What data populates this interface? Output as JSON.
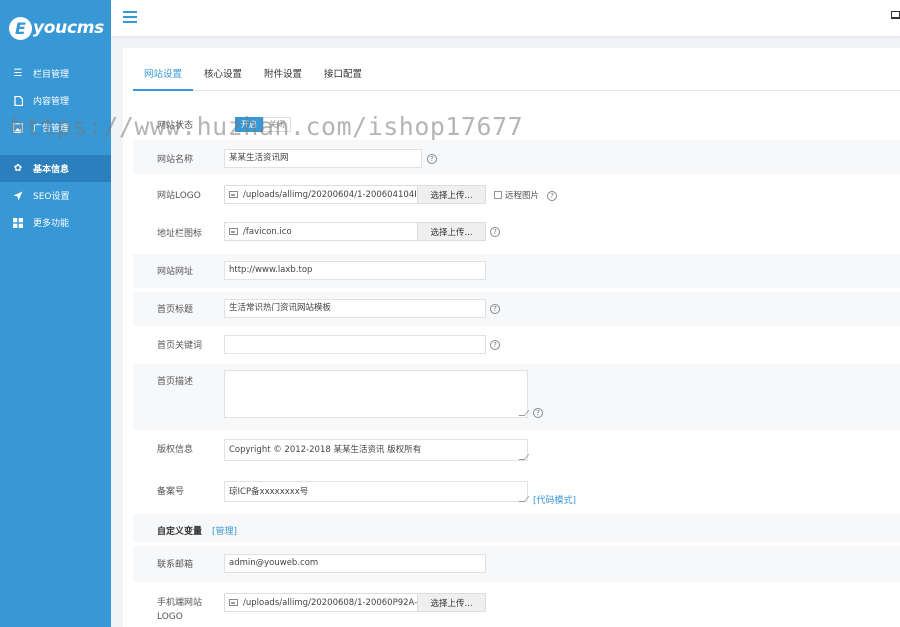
{
  "brand": {
    "badge": "E",
    "name": "youcms"
  },
  "sidebar": {
    "items": [
      {
        "label": "栏目管理",
        "icon": "list-icon"
      },
      {
        "label": "内容管理",
        "icon": "document-icon"
      },
      {
        "label": "广告管理",
        "icon": "image-icon"
      },
      {
        "label": "基本信息",
        "icon": "gear-icon",
        "active": true
      },
      {
        "label": "SEO设置",
        "icon": "send-icon"
      },
      {
        "label": "更多功能",
        "icon": "grid-icon"
      }
    ]
  },
  "tabs": [
    {
      "label": "网站设置",
      "active": true
    },
    {
      "label": "核心设置"
    },
    {
      "label": "附件设置"
    },
    {
      "label": "接口配置"
    }
  ],
  "form": {
    "status": {
      "label": "网站状态",
      "on": "开启",
      "off": "关闭"
    },
    "site_name": {
      "label": "网站名称",
      "value": "某某生活资讯网"
    },
    "site_logo": {
      "label": "网站LOGO",
      "value": "/uploads/allimg/20200604/1-200604104I",
      "button": "选择上传...",
      "remote": "远程图片"
    },
    "favicon": {
      "label": "地址栏图标",
      "value": "/favicon.ico",
      "button": "选择上传..."
    },
    "site_url": {
      "label": "网站网址",
      "value": "http://www.laxb.top"
    },
    "home_title": {
      "label": "首页标题",
      "value": "生活常识热门资讯网站模板"
    },
    "home_keywords": {
      "label": "首页关键词",
      "value": ""
    },
    "home_desc": {
      "label": "首页描述",
      "value": ""
    },
    "copyright": {
      "label": "版权信息",
      "value": "Copyright © 2012-2018 某某生活资讯 版权所有"
    },
    "icp": {
      "label": "备案号",
      "value": "琼ICP备xxxxxxxx号",
      "link": "[代码模式]"
    },
    "custom_vars": {
      "label": "自定义变量",
      "link": "[管理]"
    },
    "email": {
      "label": "联系邮箱",
      "value": "admin@youweb.com"
    },
    "mobile_logo": {
      "label_line1": "手机端网站",
      "label_line2": "LOGO",
      "value": "/uploads/allimg/20200608/1-20060P92A-",
      "button": "选择上传..."
    }
  },
  "help_glyph": "?",
  "watermark": "https://www.huzhan.com/ishop17677",
  "colors": {
    "accent": "#3898d6",
    "sidebar": "#3898d6",
    "sidebar_active": "#2b7fbc"
  }
}
